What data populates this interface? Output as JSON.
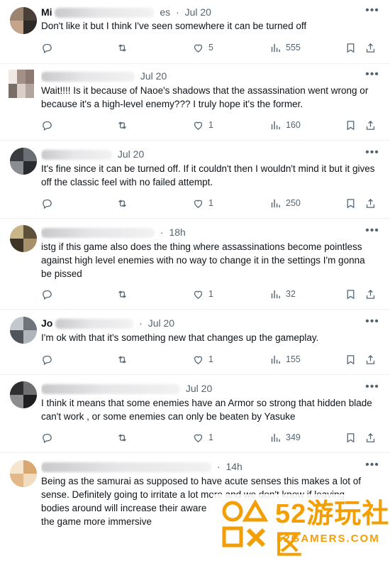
{
  "tweets": [
    {
      "name_visible": "Mi",
      "time": "Jul 20",
      "handle_tail": "es",
      "text": "Don't like it but I think I've seen somewhere it can be turned off",
      "likes": "5",
      "views": "555"
    },
    {
      "name_visible": "",
      "time": "Jul 20",
      "handle_tail": "",
      "text": "Wait!!!! Is it because of Naoe's shadows that the assassination went wrong or because it's a high-level enemy??? I truly hope it's the former.",
      "likes": "1",
      "views": "160"
    },
    {
      "name_visible": "",
      "time": "Jul 20",
      "handle_tail": "",
      "text": "It's fine since it can be turned off. If it couldn't then I wouldn't mind it but it gives off the classic feel with no failed attempt.",
      "likes": "1",
      "views": "250"
    },
    {
      "name_visible": "",
      "time": "18h",
      "handle_tail": "",
      "text": "istg if this game also does the thing where assassinations become pointless against high level enemies with no way to change it in the settings I'm gonna be pissed",
      "likes": "1",
      "views": "32"
    },
    {
      "name_visible": "Jo",
      "time": "Jul 20",
      "handle_tail": "",
      "text": "I'm ok with that it's something new that changes up the gameplay.",
      "likes": "1",
      "views": "155"
    },
    {
      "name_visible": "",
      "time": "Jul 20",
      "handle_tail": "",
      "text": "I think it means that some enemies have an Armor so strong that hidden blade can't work , or some enemies can only be beaten by Yasuke",
      "likes": "1",
      "views": "349"
    },
    {
      "name_visible": "",
      "time": "14h",
      "handle_tail": "",
      "text": "Being as the samurai as supposed to have acute senses this makes a lot of sense. Definitely going to irritate a lot more and we don't know if leaving bodies around will increase their aware",
      "text_line4": "the game more immersive",
      "likes": "",
      "views": ""
    }
  ],
  "icons": {
    "reply": "reply-icon",
    "retweet": "retweet-icon",
    "like": "heart-icon",
    "views": "views-icon",
    "bookmark": "bookmark-icon",
    "share": "share-icon",
    "more": "more-icon"
  },
  "more_label": "•••",
  "watermark": {
    "title": "52游玩社区",
    "subtitle": "52GAMERS.COM"
  },
  "colors": {
    "text": "#0f1419",
    "muted": "#536471",
    "divider": "#eff3f4",
    "watermark": "#f29f05"
  }
}
